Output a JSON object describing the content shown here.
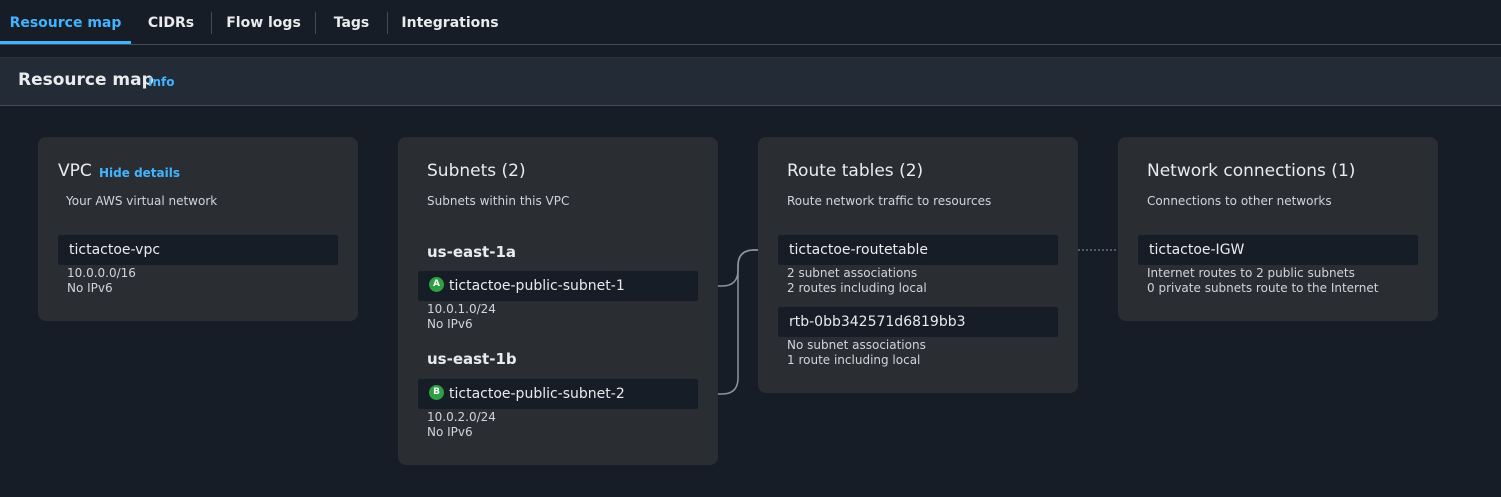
{
  "tabs": [
    {
      "label": "Resource map",
      "active": true
    },
    {
      "label": "CIDRs"
    },
    {
      "label": "Flow logs"
    },
    {
      "label": "Tags"
    },
    {
      "label": "Integrations"
    }
  ],
  "header": {
    "title": "Resource map",
    "info": "Info"
  },
  "vpc": {
    "title": "VPC",
    "hide_details": "Hide details",
    "subtitle": "Your AWS virtual network",
    "name": "tictactoe-vpc",
    "cidr": "10.0.0.0/16",
    "ipv6": "No IPv6"
  },
  "subnets": {
    "title": "Subnets (2)",
    "subtitle": "Subnets within this VPC",
    "zones": [
      {
        "az": "us-east-1a",
        "badge": "A",
        "name": "tictactoe-public-subnet-1",
        "cidr": "10.0.1.0/24",
        "ipv6": "No IPv6"
      },
      {
        "az": "us-east-1b",
        "badge": "B",
        "name": "tictactoe-public-subnet-2",
        "cidr": "10.0.2.0/24",
        "ipv6": "No IPv6"
      }
    ]
  },
  "route_tables": {
    "title": "Route tables (2)",
    "subtitle": "Route network traffic to resources",
    "items": [
      {
        "name": "tictactoe-routetable",
        "line1": "2 subnet associations",
        "line2": "2 routes including local"
      },
      {
        "name": "rtb-0bb342571d6819bb3",
        "line1": "No subnet associations",
        "line2": "1 route including local"
      }
    ]
  },
  "network": {
    "title": "Network connections (1)",
    "subtitle": "Connections to other networks",
    "items": [
      {
        "name": "tictactoe-IGW",
        "line1": "Internet routes to 2 public subnets",
        "line2": "0 private subnets route to the Internet"
      }
    ]
  },
  "colors": {
    "background": "#161d26",
    "card": "#2a2e33",
    "accent": "#42b4ff",
    "badge": "#2ea043",
    "connector": "#8a96a3"
  }
}
